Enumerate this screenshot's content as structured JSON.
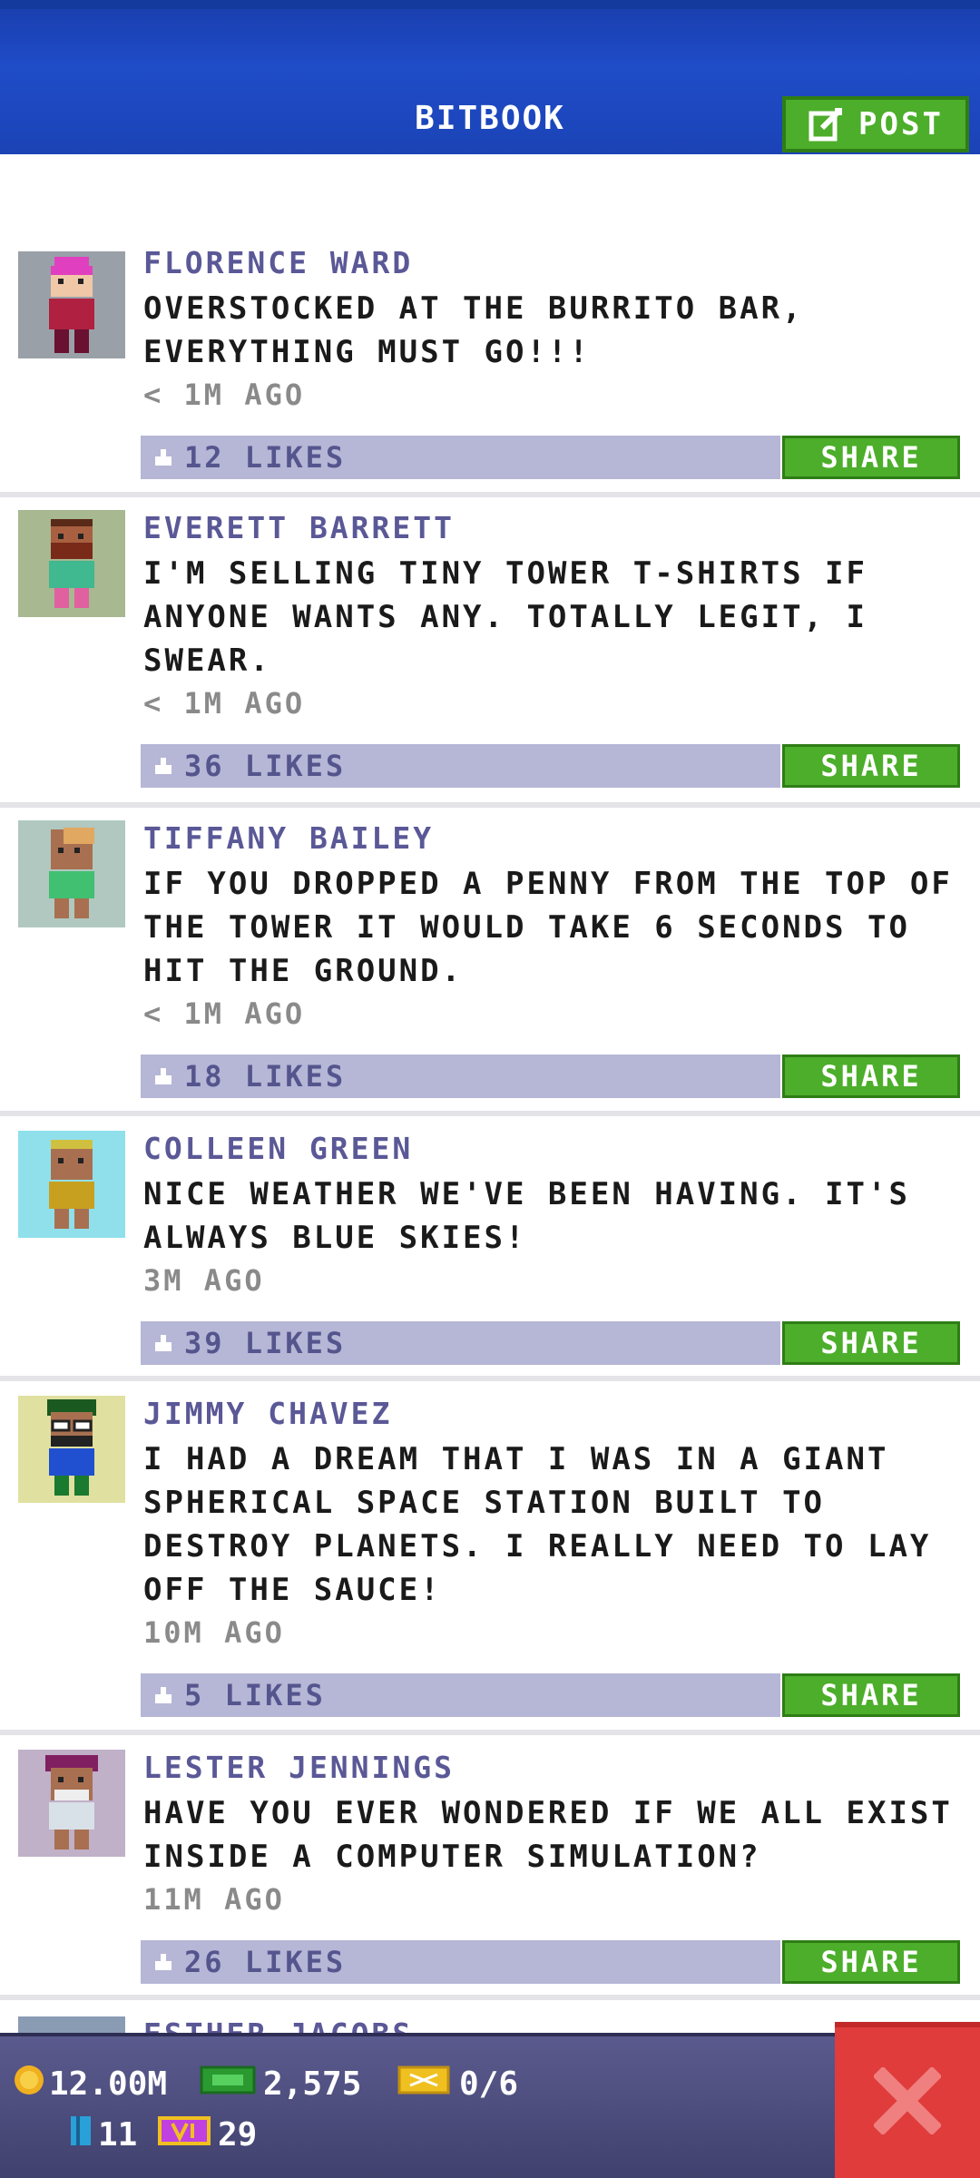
{
  "header": {
    "title": "BITBOOK",
    "post_label": "POST"
  },
  "posts": [
    {
      "author": "FLORENCE WARD",
      "message": "OVERSTOCKED AT THE BURRITO BAR, EVERYTHING MUST GO!!!",
      "time": "< 1M AGO",
      "likes": "12 LIKES",
      "share": "SHARE"
    },
    {
      "author": "EVERETT BARRETT",
      "message": "I'M SELLING TINY TOWER T-SHIRTS IF ANYONE WANTS ANY. TOTALLY LEGIT, I SWEAR.",
      "time": "< 1M AGO",
      "likes": "36 LIKES",
      "share": "SHARE"
    },
    {
      "author": "TIFFANY BAILEY",
      "message": "IF YOU DROPPED A PENNY FROM THE TOP OF THE TOWER IT WOULD TAKE 6 SECONDS TO HIT THE GROUND.",
      "time": "< 1M AGO",
      "likes": "18 LIKES",
      "share": "SHARE"
    },
    {
      "author": "COLLEEN GREEN",
      "message": "NICE WEATHER WE'VE BEEN HAVING. IT'S ALWAYS BLUE SKIES!",
      "time": "3M AGO",
      "likes": "39 LIKES",
      "share": "SHARE"
    },
    {
      "author": "JIMMY CHAVEZ",
      "message": "I HAD A DREAM THAT I WAS IN A GIANT SPHERICAL SPACE STATION BUILT TO DESTROY PLANETS. I REALLY NEED TO LAY OFF THE SAUCE!",
      "time": "10M AGO",
      "likes": "5 LIKES",
      "share": "SHARE"
    },
    {
      "author": "LESTER JENNINGS",
      "message": "HAVE YOU EVER WONDERED IF WE ALL EXIST INSIDE A COMPUTER SIMULATION?",
      "time": "11M AGO",
      "likes": "26 LIKES",
      "share": "SHARE"
    }
  ],
  "partial_post": {
    "author": "ESTHER JACOBS"
  },
  "footer": {
    "coins": "12.00M",
    "bux": "2,575",
    "tickets": "0/6",
    "floors": "11",
    "vip": "29"
  },
  "colors": {
    "header_blue": "#1f4cc8",
    "share_green": "#4cae2a",
    "likes_bar": "#b6b6d6",
    "author_purple": "#5a5896",
    "close_red": "#e03c3c"
  }
}
